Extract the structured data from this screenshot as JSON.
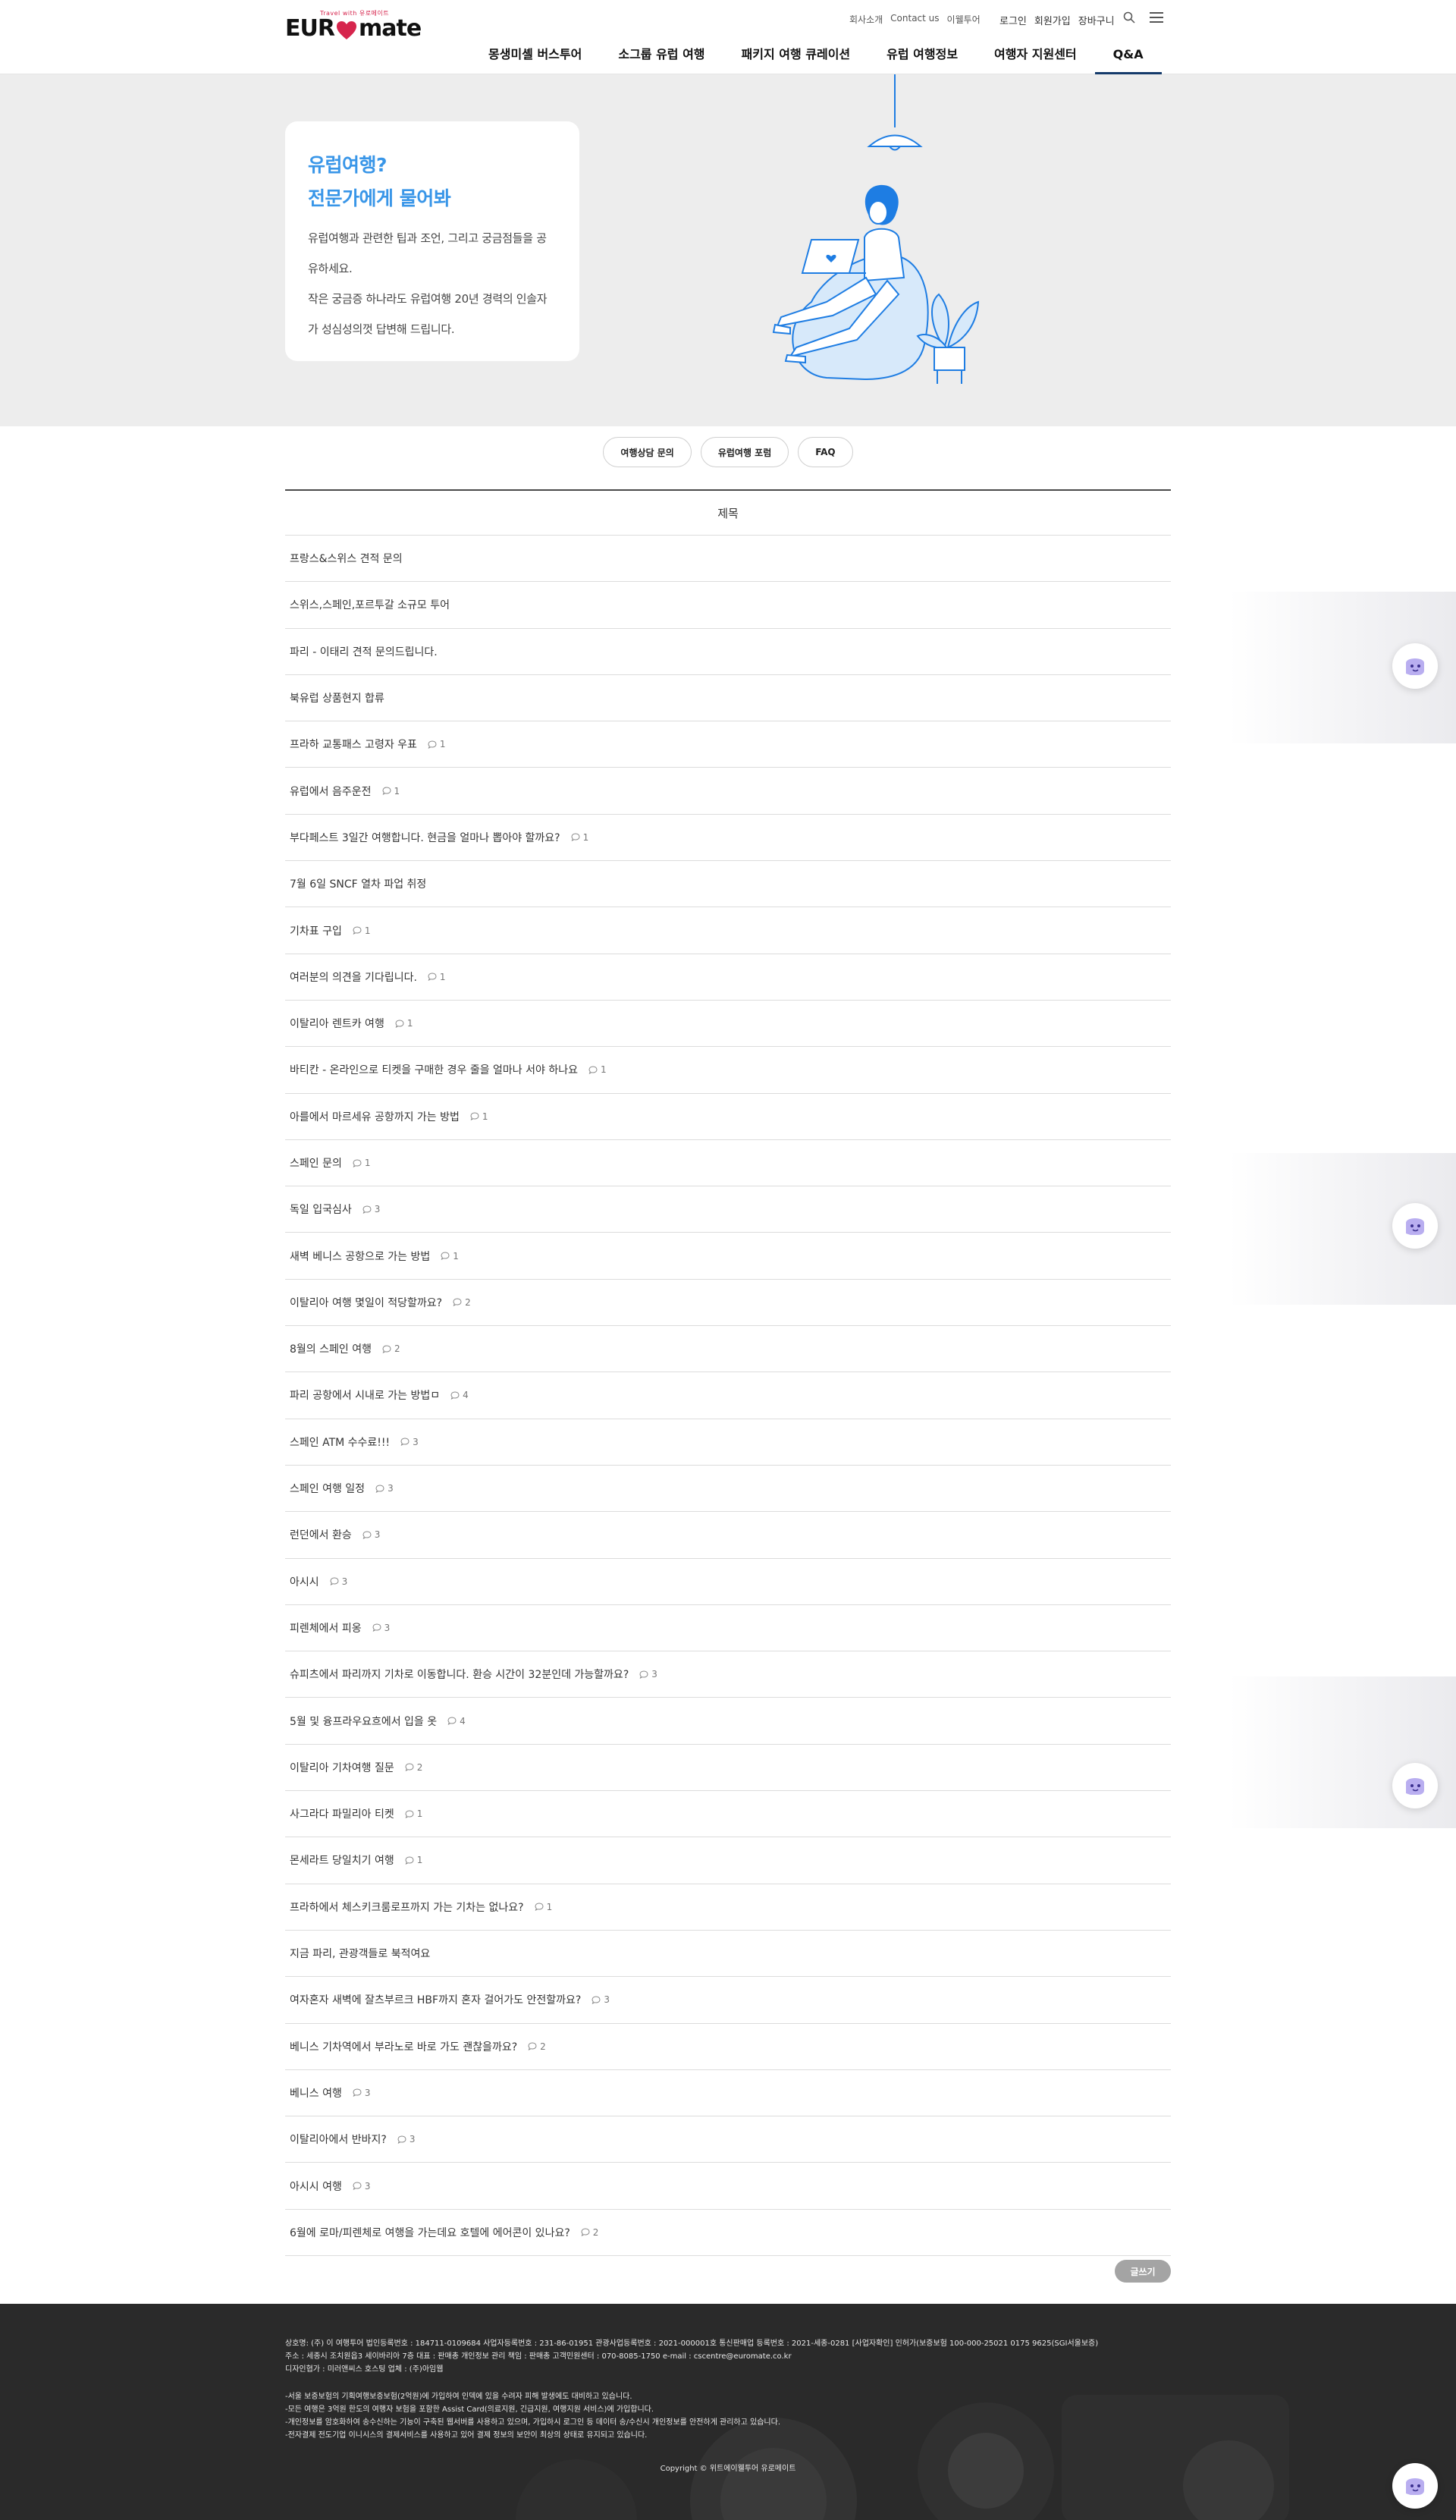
{
  "header": {
    "logo_main_left": "EUR",
    "logo_main_right": "mate",
    "logo_sub": "Travel with 유로메이트",
    "util_left": [
      "회사소개",
      "Contact us",
      "이웰투어"
    ],
    "util_right": [
      "로그인",
      "회원가입",
      "장바구니"
    ],
    "nav": [
      "몽생미셸 버스투어",
      "소그룹 유럽 여행",
      "패키지 여행 큐레이션",
      "유럽 여행정보",
      "여행자 지원센터",
      "Q&A"
    ],
    "active_nav": "Q&A",
    "brand_color": "#d6254d",
    "icons": [
      "search-icon",
      "menu-icon"
    ]
  },
  "hero": {
    "title_line1": "유럽여행?",
    "title_line2": "전문가에게 물어봐",
    "desc_line1": "유럽여행과 관련한 팁과 조언, 그리고 궁금점들을 공",
    "desc_line2": "유하세요.",
    "desc_line3": "작은 궁금증 하나라도 유럽여행 20년 경력의 인솔자",
    "desc_line4": "가 성심성의껏 답변해 드립니다.",
    "accent": "#3996e8"
  },
  "tabs": [
    "여행상담 문의",
    "유럽여행 포럼",
    "FAQ"
  ],
  "board": {
    "header": "제목",
    "rows": [
      {
        "title": "프랑스&스위스 견적 문의",
        "comments": ""
      },
      {
        "title": "스위스,스페인,포르투갈 소규모 투어",
        "comments": ""
      },
      {
        "title": "파리 - 이태리 견적 문의드립니다.",
        "comments": ""
      },
      {
        "title": "북유럽 상품현지 합류",
        "comments": ""
      },
      {
        "title": "프라하 교통패스 고령자 우표",
        "comments": "1"
      },
      {
        "title": "유럽에서 음주운전",
        "comments": "1"
      },
      {
        "title": "부다페스트 3일간 여행합니다. 현금을 얼마나 뽑아야 할까요?",
        "comments": "1"
      },
      {
        "title": "7월 6일 SNCF 열차 파업 취정",
        "comments": ""
      },
      {
        "title": "기차표 구입",
        "comments": "1"
      },
      {
        "title": "여러분의 의견을 기다립니다.",
        "comments": "1"
      },
      {
        "title": "이탈리아 렌트카 여행",
        "comments": "1"
      },
      {
        "title": "바티칸 - 온라인으로 티켓을 구매한 경우 줄을 얼마나 서야 하나요",
        "comments": "1"
      },
      {
        "title": "아를에서 마르세유 공항까지 가는 방법",
        "comments": "1"
      },
      {
        "title": "스페인 문의",
        "comments": "1"
      },
      {
        "title": "독일 입국심사",
        "comments": "3"
      },
      {
        "title": "새벽 베니스 공항으로 가는 방법",
        "comments": "1"
      },
      {
        "title": "이탈리아 여행 몇일이 적당할까요?",
        "comments": "2"
      },
      {
        "title": "8월의 스페인 여행",
        "comments": "2"
      },
      {
        "title": "파리 공항에서 시내로 가는 방법ㅁ",
        "comments": "4"
      },
      {
        "title": "스페인 ATM 수수료!!!",
        "comments": "3"
      },
      {
        "title": "스페인 여행 일정",
        "comments": "3"
      },
      {
        "title": "런던에서 환승",
        "comments": "3"
      },
      {
        "title": "아시시",
        "comments": "3"
      },
      {
        "title": "피렌체에서 피옹",
        "comments": "3"
      },
      {
        "title": "슈피츠에서 파리까지 기차로 이동합니다. 환승 시간이 32분인데 가능할까요?",
        "comments": "3"
      },
      {
        "title": "5월 및 융프라우요흐에서 입을 옷",
        "comments": "4"
      },
      {
        "title": "이탈리아 기차여행 질문",
        "comments": "2"
      },
      {
        "title": "사그라다 파밀리아 티켓",
        "comments": "1"
      },
      {
        "title": "몬세라트 당일치기 여행",
        "comments": "1"
      },
      {
        "title": "프라하에서 체스키크룸로프까지 가는 기차는 없나요?",
        "comments": "1"
      },
      {
        "title": "지금 파리, 관광객들로 북적여요",
        "comments": ""
      },
      {
        "title": "여자혼자 새벽에 잘츠부르크 HBF까지 혼자 걸어가도 안전할까요?",
        "comments": "3"
      },
      {
        "title": "베니스 기차역에서 부라노로 바로 가도 괜찮을까요?",
        "comments": "2"
      },
      {
        "title": "베니스 여행",
        "comments": "3"
      },
      {
        "title": "이탈리아에서 반바지?",
        "comments": "3"
      },
      {
        "title": "아시시 여행",
        "comments": "3"
      },
      {
        "title": "6월에 로마/피렌체로 여행을 가는데요 호텔에 에어콘이 있나요?",
        "comments": "2"
      }
    ]
  },
  "write_button": "글쓰기",
  "footer": {
    "info_line1": "상호명: (주) 이 여행투어 법인등록번호 : 184711-0109684 사업자등록번호 : 231-86-01951 관광사업등록번호 : 2021-000001호 통신판매업 등록번호 : 2021-세종-0281 [사업자확인] 인허가(보증보험 100-000-25021 0175 9625(SGI서울보증)",
    "info_line2": "주소 : 세종시 조치원읍3 세이바리아 7층 대표 : 판매총 개인정보 관리 책임 : 판매총 고객민원센터 : 070-8085-1750 e-mail : cscentre@euromate.co.kr",
    "info_line3": "디자인협가 : 미러앤씨스 호스팅 업체 : (주)아임웹",
    "notes": [
      "-서울 보증보험의 기획여행보증보험(2억원)에 가입하여 인덱에 있을 수려자 피해 발생에도 대비하고 있습니다.",
      "-모든 여행은 3억원 한도의 여행자 보험을 포함한 Assist Card(의료지원, 긴급지원, 여행지원 서비스)에 가입합니다.",
      "-개인정보를 암호화하여 송수신하는 기능이 구축된 웹서버를 사용하고 있으며, 가입하시 로그인 등 데이터 송/수신시 개인정보를 안전하게 관리하고 있습니다.",
      "-전자결제 전도기업 이니시스의 결제서비스를 사용하고 있어 결제 정보의 보안이 최상의 상태로 유지되고 있습니다."
    ],
    "copyright": "Copyright © 위트에이웰투어 유로메이트"
  }
}
